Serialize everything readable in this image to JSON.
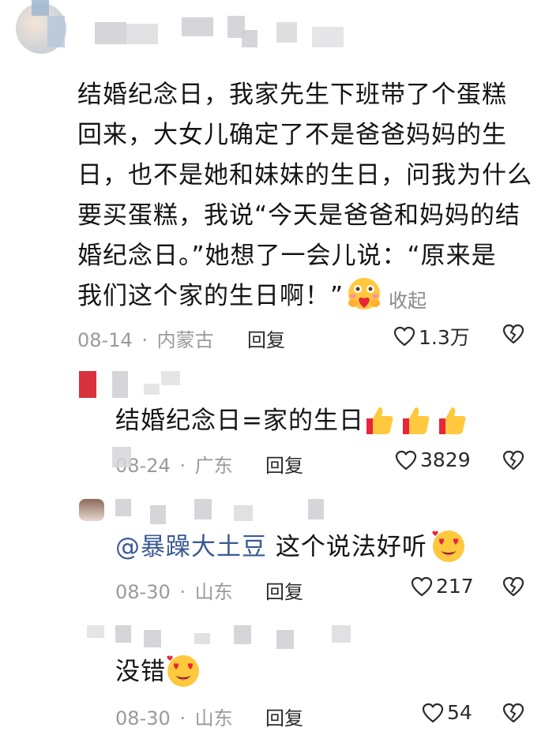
{
  "comments": [
    {
      "lines": [
        "结婚纪念日，我家先生下班带了个蛋糕",
        "回来，大女儿确定了不是爸爸妈妈的生",
        "日，也不是她和妹妹的生日，问我为什么",
        "要买蛋糕，我说“今天是爸爸和妈妈的结",
        "婚纪念日。”她想了一会儿说：“原来是",
        "我们这个家的生日啊！”"
      ],
      "collapse_label": "收起",
      "date": "08-14",
      "location": "内蒙古",
      "reply_label": "回复",
      "likes": "1.3万"
    },
    {
      "text": "结婚纪念日=家的生日",
      "date": "08-24",
      "location": "广东",
      "reply_label": "回复",
      "likes": "3829"
    },
    {
      "mention": "@暴躁大土豆",
      "text": " 这个说法好听",
      "date": "08-30",
      "location": "山东",
      "reply_label": "回复",
      "likes": "217"
    },
    {
      "text": "没错",
      "date": "08-30",
      "location": "山东",
      "reply_label": "回复",
      "likes": "54"
    }
  ],
  "separator": "·",
  "icons": {
    "like": "heart-outline-icon",
    "dislike": "broken-heart-icon",
    "hug_emoji": "hug-emoji-icon",
    "thumbs_up_emoji": "thumbs-up-emoji-icon",
    "heart_eyes_emoji": "heart-eyes-emoji-icon"
  },
  "colors": {
    "text": "#141414",
    "meta": "#9a9a9a",
    "mention": "#3a5a93"
  }
}
